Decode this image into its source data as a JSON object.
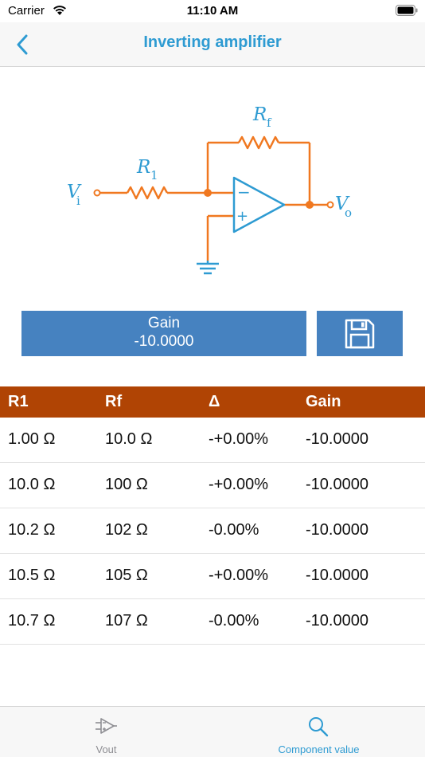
{
  "status_bar": {
    "carrier": "Carrier",
    "time": "11:10 AM"
  },
  "nav": {
    "title": "Inverting amplifier",
    "back_icon": "chevron-left-icon"
  },
  "circuit": {
    "vi_main": "V",
    "vi_sub": "i",
    "r1_main": "R",
    "r1_sub": "1",
    "rf_main": "R",
    "rf_sub": "f",
    "vo_main": "V",
    "vo_sub": "o",
    "minus": "−",
    "plus": "+",
    "wire_color": "#f07820",
    "component_color": "#2e9bd2"
  },
  "gain": {
    "label": "Gain",
    "value": "-10.0000"
  },
  "save": {
    "icon": "floppy-disk-icon"
  },
  "table": {
    "header_color": "#b04404",
    "columns": [
      "R1",
      "Rf",
      "Δ",
      "Gain"
    ],
    "rows": [
      [
        "1.00 Ω",
        "10.0 Ω",
        "-+0.00%",
        "-10.0000"
      ],
      [
        "10.0 Ω",
        "100 Ω",
        "-+0.00%",
        "-10.0000"
      ],
      [
        "10.2 Ω",
        "102 Ω",
        "-0.00%",
        "-10.0000"
      ],
      [
        "10.5 Ω",
        "105 Ω",
        "-+0.00%",
        "-10.0000"
      ],
      [
        "10.7 Ω",
        "107 Ω",
        "-0.00%",
        "-10.0000"
      ]
    ]
  },
  "tabs": [
    {
      "label": "Vout",
      "icon": "op-amp-icon",
      "selected": false
    },
    {
      "label": "Component value",
      "icon": "search-icon",
      "selected": true
    }
  ]
}
